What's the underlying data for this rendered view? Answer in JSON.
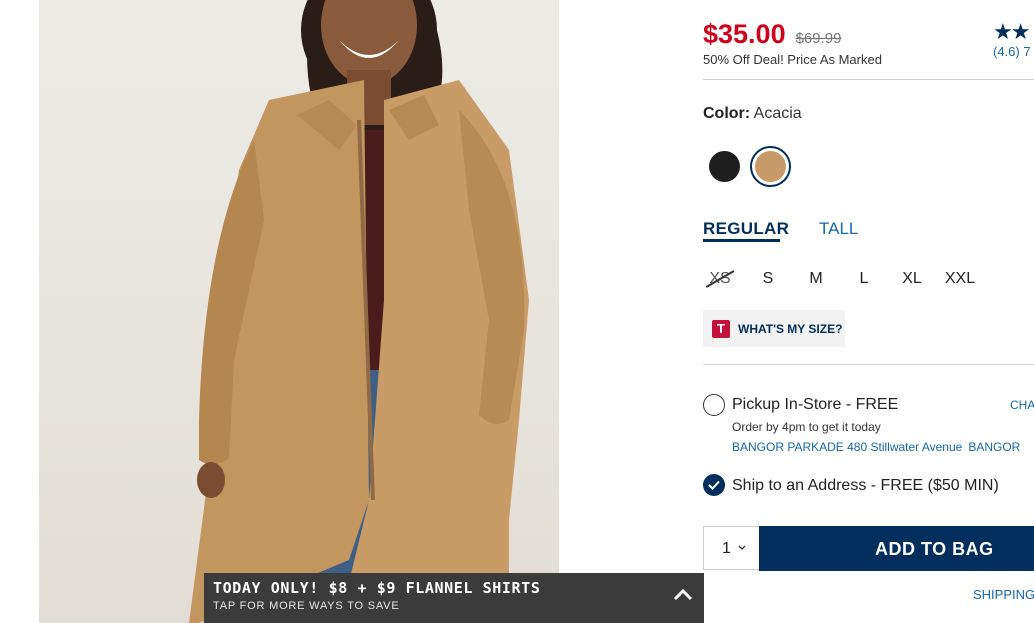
{
  "product": {
    "sale_price": "$35.00",
    "original_price": "$69.99",
    "deal_text": "50% Off Deal! Price As Marked",
    "rating_stars": "★★",
    "rating_text": "(4.6) 7"
  },
  "color": {
    "label": "Color:",
    "selected": "Acacia",
    "swatches": [
      {
        "name": "Black",
        "hex": "#1e1e1e"
      },
      {
        "name": "Acacia",
        "hex": "#c89a6a"
      }
    ]
  },
  "fit": {
    "tabs": [
      {
        "label": "REGULAR",
        "selected": true
      },
      {
        "label": "TALL",
        "selected": false
      }
    ]
  },
  "sizes": [
    {
      "label": "XS",
      "available": false
    },
    {
      "label": "S",
      "available": true
    },
    {
      "label": "M",
      "available": true
    },
    {
      "label": "L",
      "available": true
    },
    {
      "label": "XL",
      "available": true
    },
    {
      "label": "XXL",
      "available": true
    }
  ],
  "size_help": {
    "icon_letter": "T",
    "label": "WHAT'S MY SIZE?"
  },
  "fulfillment": {
    "pickup": {
      "label": "Pickup In-Store - FREE",
      "change_label": "CHA",
      "sub": "Order by 4pm to get it today",
      "store_name": "BANGOR PARKADE 480 Stillwater Avenue",
      "store_city": "BANGOR",
      "selected": false
    },
    "ship": {
      "label": "Ship to an Address - FREE ($50 MIN)",
      "selected": true
    }
  },
  "cart": {
    "quantity": "1",
    "add_label": "ADD TO BAG",
    "shipping_link": "SHIPPING"
  },
  "promo": {
    "title": "TODAY ONLY! $8 + $9 FLANNEL SHIRTS",
    "subtitle": "TAP FOR MORE WAYS TO SAVE"
  },
  "colors": {
    "sale_red": "#d0021b",
    "navy": "#002e5d",
    "link_blue": "#1467b1",
    "promo_bg": "#3b3b3b"
  }
}
